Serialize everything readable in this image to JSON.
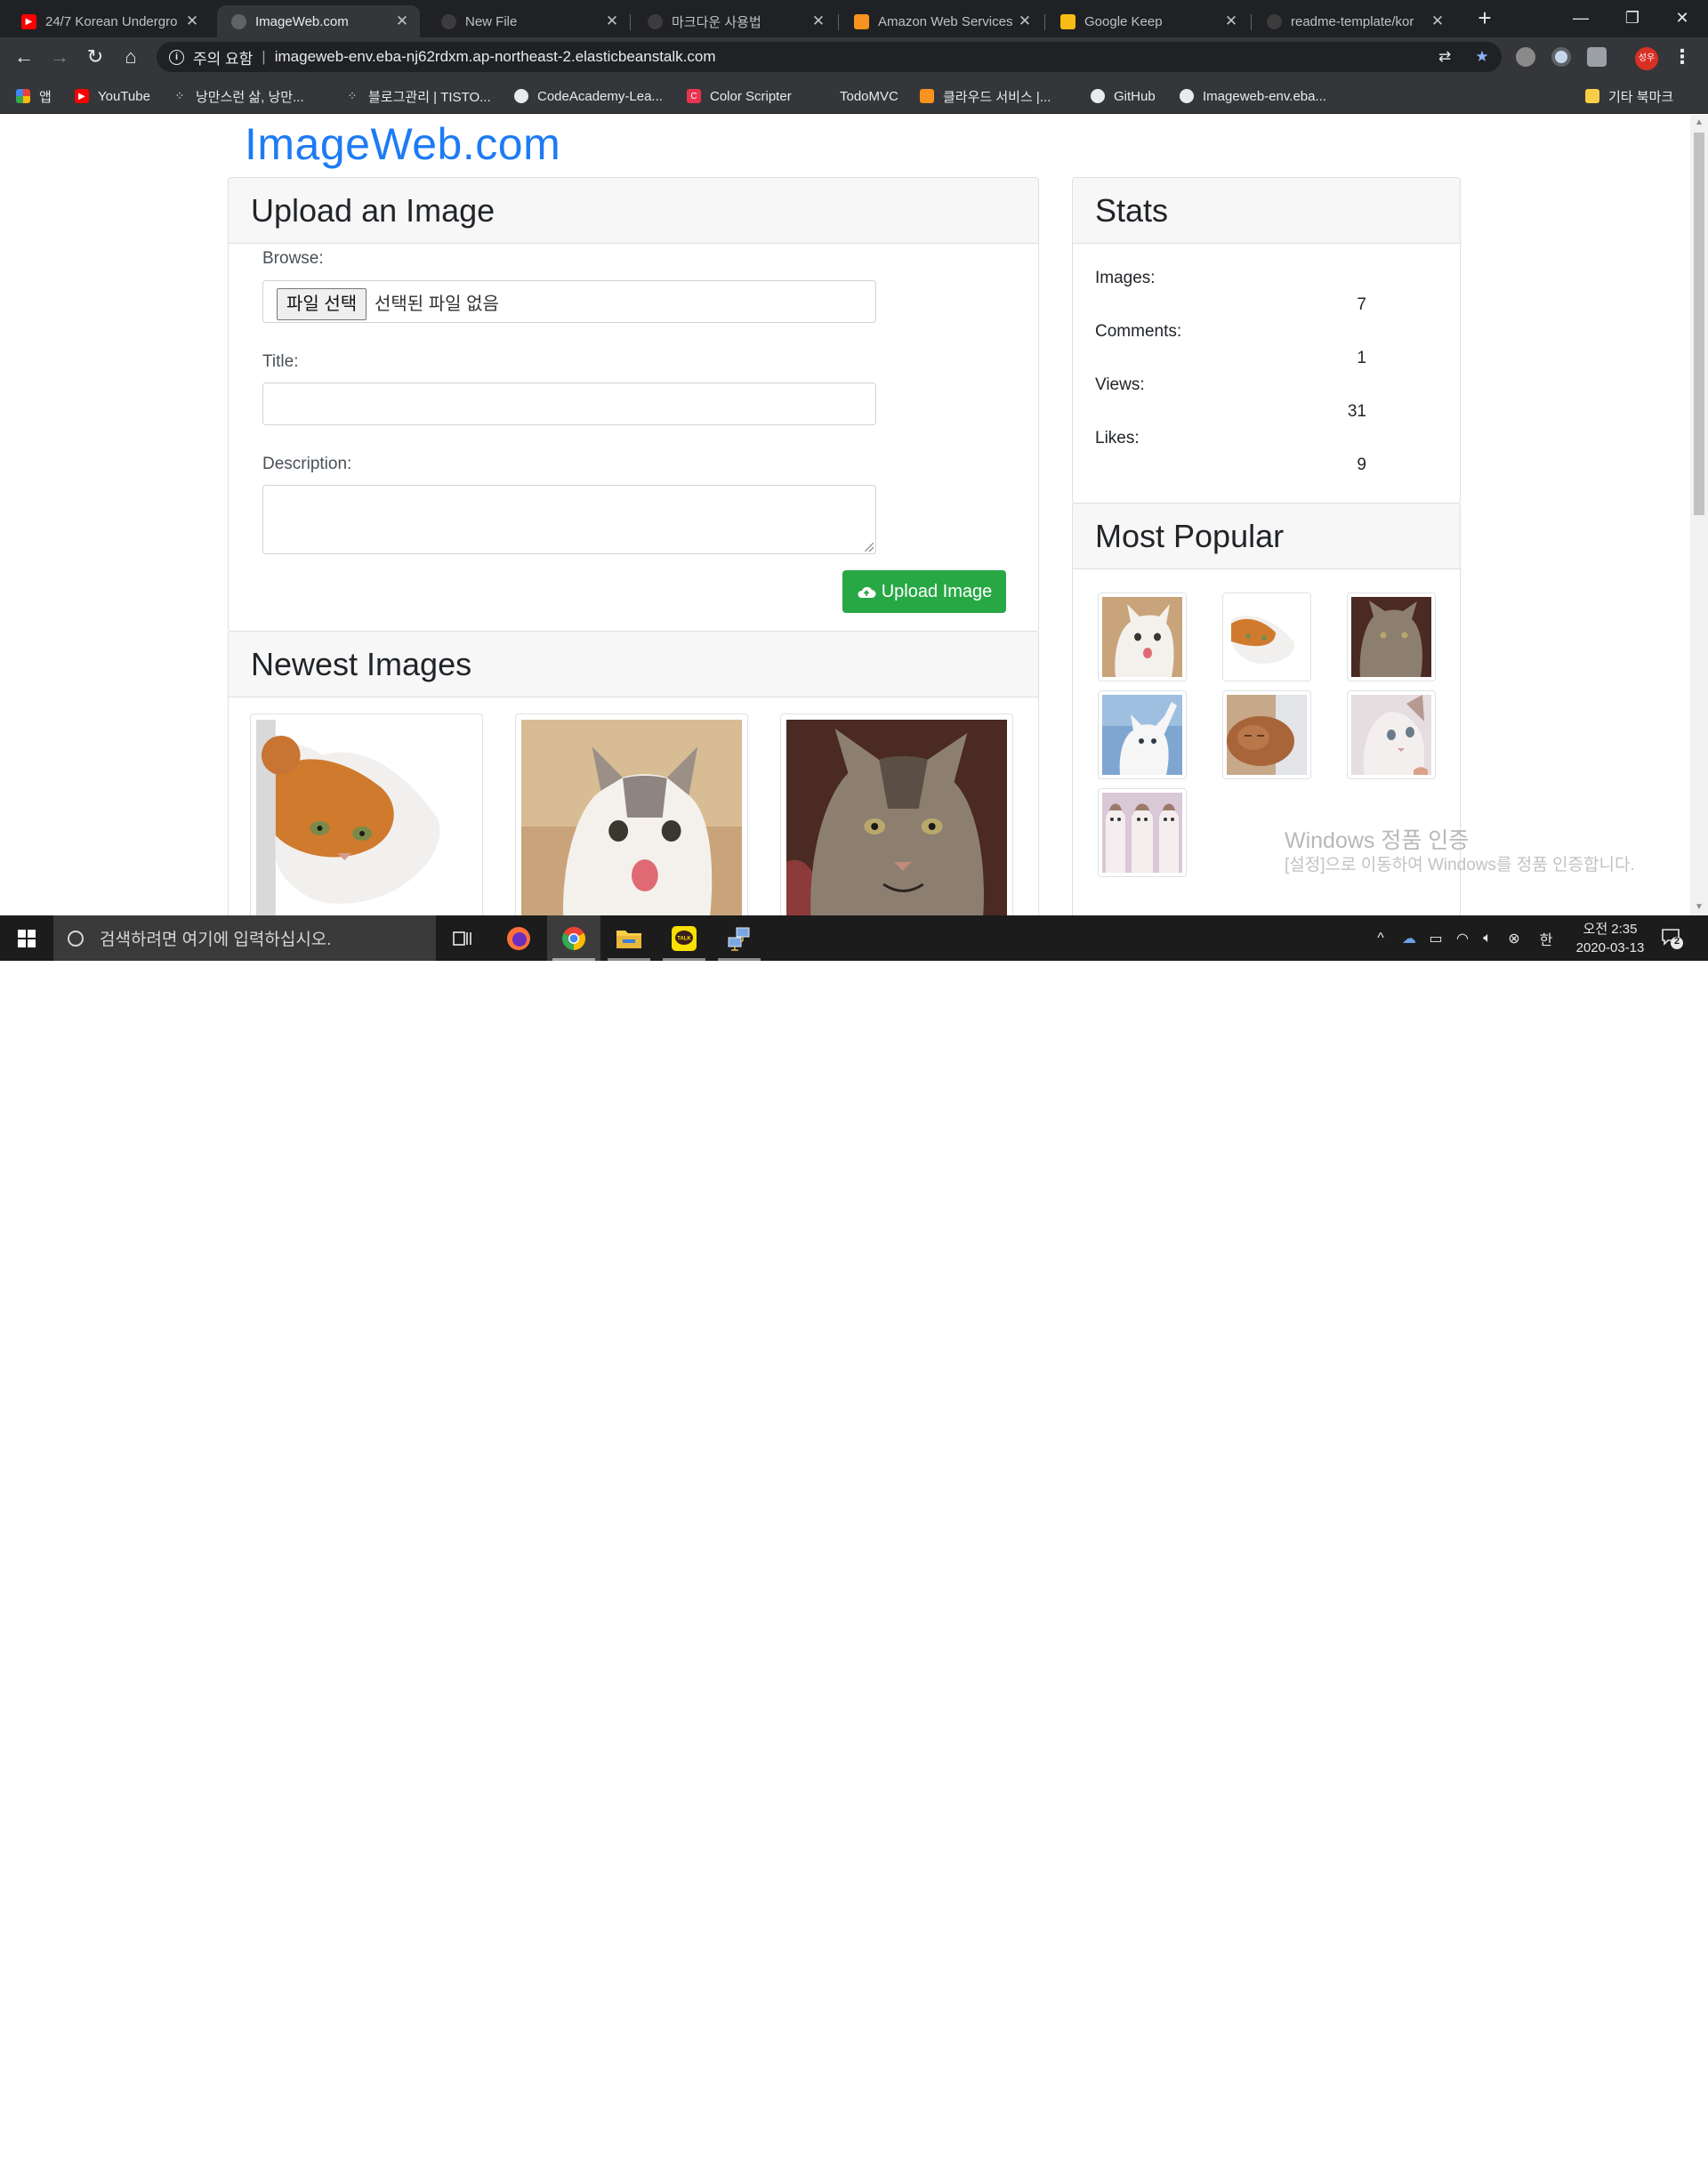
{
  "browser": {
    "tabs": [
      {
        "title": "24/7 Korean Undergro",
        "favicon": "youtube-icon",
        "color": "#ff0000"
      },
      {
        "title": "ImageWeb.com",
        "favicon": "globe-icon",
        "color": "#5f6368"
      },
      {
        "title": "New File",
        "favicon": "github-icon",
        "color": "#3c3c3c"
      },
      {
        "title": "마크다운 사용법",
        "favicon": "github-icon",
        "color": "#3c3c3c"
      },
      {
        "title": "Amazon Web Services",
        "favicon": "aws-cube-icon",
        "color": "#f7931e"
      },
      {
        "title": "Google Keep",
        "favicon": "keep-icon",
        "color": "#f9bc15"
      },
      {
        "title": "readme-template/kor",
        "favicon": "github-icon",
        "color": "#3c3c3c"
      }
    ],
    "active_tab_index": 1,
    "omnibox": {
      "security_label": "주의 요함",
      "url": "imageweb-env.eba-nj62rdxm.ap-northeast-2.elasticbeanstalk.com"
    },
    "profile_initials": "성우",
    "bookmarks": [
      {
        "label": "앱",
        "icon": "apps-grid-icon"
      },
      {
        "label": "YouTube",
        "icon": "youtube-icon"
      },
      {
        "label": "낭만스런 삶, 낭만...",
        "icon": "tistory-icon"
      },
      {
        "label": "블로그관리 | TISTO...",
        "icon": "tistory-icon"
      },
      {
        "label": "CodeAcademy-Lea...",
        "icon": "globe-icon"
      },
      {
        "label": "Color Scripter",
        "icon": "color-scripter-icon"
      },
      {
        "label": "TodoMVC",
        "icon": "blank-icon"
      },
      {
        "label": "클라우드 서비스 |...",
        "icon": "aws-cube-icon"
      },
      {
        "label": "GitHub",
        "icon": "github-icon"
      },
      {
        "label": "Imageweb-env.eba...",
        "icon": "globe-icon"
      }
    ],
    "other_bookmarks": "기타 북마크"
  },
  "page": {
    "brand": "ImageWeb.com",
    "upload": {
      "heading": "Upload an Image",
      "browse_label": "Browse:",
      "file_button": "파일 선택",
      "file_status": "선택된 파일 없음",
      "title_label": "Title:",
      "title_value": "",
      "description_label": "Description:",
      "description_value": "",
      "submit_label": "Upload Image"
    },
    "newest": {
      "heading": "Newest Images",
      "images": [
        {
          "name": "orange-white-cat-peeking"
        },
        {
          "name": "white-kitten-meowing"
        },
        {
          "name": "grumpy-tabby-cat"
        }
      ]
    },
    "stats": {
      "heading": "Stats",
      "items": [
        {
          "label": "Images:",
          "value": "7"
        },
        {
          "label": "Comments:",
          "value": "1"
        },
        {
          "label": "Views:",
          "value": "31"
        },
        {
          "label": "Likes:",
          "value": "9"
        }
      ]
    },
    "popular": {
      "heading": "Most Popular",
      "count": 7
    },
    "watermark": {
      "line1": "Windows 정품 인증",
      "line2": "[설정]으로 이동하여 Windows를 정품 인증합니다."
    }
  },
  "taskbar": {
    "search_placeholder": "검색하려면 여기에 입력하십시오.",
    "ime": "한",
    "time": "오전 2:35",
    "date": "2020-03-13",
    "notifications": "2"
  },
  "colors": {
    "brand_blue": "#1d7bf5",
    "success_green": "#28a745",
    "chrome_dark": "#202124",
    "chrome_toolbar": "#35363a"
  }
}
